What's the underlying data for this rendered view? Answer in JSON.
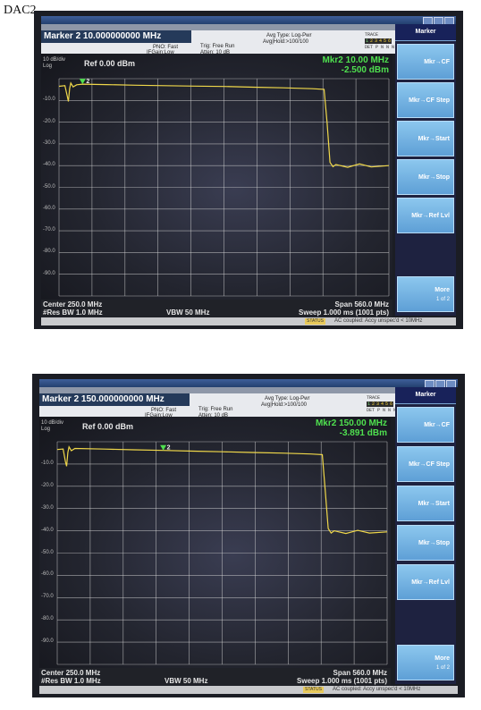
{
  "page_label": "DAC2",
  "screenshots": [
    {
      "marker_title": "Marker 2 10.000000000 MHz",
      "input_line1": "PNO: Fast",
      "input_line2": "IFGain:Low",
      "trig": "Trig: Free Run",
      "atten": "Atten: 10 dB",
      "avg_type": "Avg Type: Log-Pwr",
      "avg_hold": "Avg|Hold:>100/100",
      "trace_label": "TRACE",
      "trace_nums": [
        "1",
        "2",
        "3",
        "4",
        "5",
        "6"
      ],
      "type_row": "TYPE W",
      "det_row": "DET P N N N N N",
      "scale": "10 dB/div",
      "scale_mode": "Log",
      "ref_level": "Ref 0.00 dBm",
      "marker_freq": "Mkr2 10.00 MHz",
      "marker_amp": "-2.500 dBm",
      "y_ticks": [
        "-10.0",
        "-20.0",
        "-30.0",
        "-40.0",
        "-50.0",
        "-60.0",
        "-70.0",
        "-80.0",
        "-90.0"
      ],
      "center": "Center 250.0 MHz",
      "res_bw": "#Res BW 1.0 MHz",
      "vbw": "VBW 50 MHz",
      "span": "Span 560.0 MHz",
      "sweep": "Sweep  1.000 ms (1001 pts)",
      "status": "AC coupled: Accy unspec'd < 10MHz",
      "status_badge": "STATUS",
      "softkeys_title": "Marker",
      "softkeys": [
        "Mkr→CF",
        "Mkr→CF Step",
        "Mkr→Start",
        "Mkr→Stop",
        "Mkr→Ref Lvl"
      ],
      "more_label": "More",
      "more_page": "1 of 2",
      "trace_color": "#f0d84a",
      "marker_color": "#4fe04f"
    },
    {
      "marker_title": "Marker 2 150.000000000 MHz",
      "input_line1": "PNO: Fast",
      "input_line2": "IFGain:Low",
      "trig": "Trig: Free Run",
      "atten": "Atten: 10 dB",
      "avg_type": "Avg Type: Log-Pwr",
      "avg_hold": "Avg|Hold:>100/100",
      "trace_label": "TRACE",
      "trace_nums": [
        "1",
        "2",
        "3",
        "4",
        "5",
        "6"
      ],
      "type_row": "TYPE W",
      "det_row": "DET P N N N N N",
      "scale": "10 dB/div",
      "scale_mode": "Log",
      "ref_level": "Ref 0.00 dBm",
      "marker_freq": "Mkr2 150.00 MHz",
      "marker_amp": "-3.891 dBm",
      "y_ticks": [
        "-10.0",
        "-20.0",
        "-30.0",
        "-40.0",
        "-50.0",
        "-60.0",
        "-70.0",
        "-80.0",
        "-90.0"
      ],
      "center": "Center 250.0 MHz",
      "res_bw": "#Res BW 1.0 MHz",
      "vbw": "VBW 50 MHz",
      "span": "Span 560.0 MHz",
      "sweep": "Sweep  1.000 ms (1001 pts)",
      "status": "AC coupled: Accy unspec'd < 10MHz",
      "status_badge": "STATUS",
      "softkeys_title": "Marker",
      "softkeys": [
        "Mkr→CF",
        "Mkr→CF Step",
        "Mkr→Start",
        "Mkr→Stop",
        "Mkr→Ref Lvl"
      ],
      "more_label": "More",
      "more_page": "1 of 2",
      "trace_color": "#f0d84a",
      "marker_color": "#4fe04f"
    }
  ],
  "chart_data": [
    {
      "type": "line",
      "x_unit": "MHz",
      "x_range": [
        -30,
        530
      ],
      "ylim": [
        -100,
        0
      ],
      "grid": true,
      "series": [
        {
          "x": [
            -30,
            -20,
            -16,
            -14,
            -12,
            -10,
            -6,
            0,
            10,
            50,
            100,
            150,
            200,
            250,
            300,
            350,
            400,
            420,
            425,
            430,
            435,
            440,
            460,
            480,
            500,
            530
          ],
          "y": [
            -3.5,
            -3.2,
            -8.0,
            -10.5,
            -4.5,
            -2.0,
            -3.8,
            -2.8,
            -2.5,
            -2.7,
            -3.0,
            -3.2,
            -3.4,
            -3.6,
            -3.9,
            -4.2,
            -4.6,
            -4.9,
            -20.0,
            -38.5,
            -40.5,
            -39.5,
            -40.8,
            -39.2,
            -40.6,
            -40.0
          ]
        }
      ],
      "markers": [
        {
          "label": "2",
          "x": 10.0,
          "y": -2.5
        }
      ]
    },
    {
      "type": "line",
      "x_unit": "MHz",
      "x_range": [
        -30,
        530
      ],
      "ylim": [
        -100,
        0
      ],
      "grid": true,
      "series": [
        {
          "x": [
            -30,
            -20,
            -16,
            -14,
            -12,
            -10,
            -6,
            0,
            50,
            100,
            150,
            200,
            250,
            300,
            350,
            400,
            420,
            425,
            430,
            435,
            440,
            460,
            480,
            500,
            530
          ],
          "y": [
            -3.5,
            -3.3,
            -9.0,
            -11.0,
            -4.8,
            -2.3,
            -4.0,
            -3.0,
            -3.3,
            -3.6,
            -3.9,
            -4.2,
            -4.5,
            -4.8,
            -5.1,
            -5.5,
            -5.8,
            -22.0,
            -39.0,
            -41.0,
            -40.0,
            -41.2,
            -39.8,
            -41.0,
            -40.5
          ]
        }
      ],
      "markers": [
        {
          "label": "2",
          "x": 150.0,
          "y": -3.891
        }
      ]
    }
  ]
}
